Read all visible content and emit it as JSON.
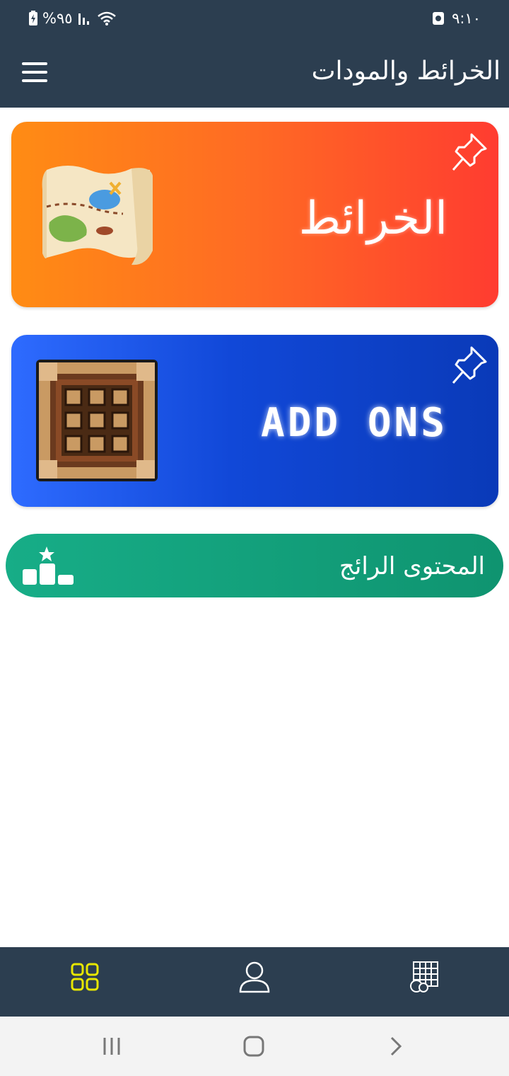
{
  "status_bar": {
    "battery": "%٩٥",
    "time": "٩:١٠"
  },
  "app_bar": {
    "title": "الخرائط والمودات",
    "menu_icon": "hamburger-menu-icon"
  },
  "cards": {
    "maps": {
      "label": "الخرائط",
      "gradient": [
        "#ff8c14",
        "#ff3c30"
      ],
      "image": "treasure-map-icon",
      "pin_icon": "pin-icon"
    },
    "addons": {
      "label": "ADD ONS",
      "gradient": [
        "#2e6bff",
        "#0a3ab8"
      ],
      "image": "crafting-table-icon",
      "pin_icon": "pin-icon"
    }
  },
  "trending": {
    "label": "المحتوى الرائج",
    "icon": "podium-star-icon",
    "color": "#17ad87"
  },
  "bottom_nav": {
    "items": [
      {
        "icon": "grid-icon",
        "active": true,
        "color": "#e6e600"
      },
      {
        "icon": "user-icon",
        "active": false
      },
      {
        "icon": "map-fruit-icon",
        "active": false
      }
    ]
  },
  "system_nav": {
    "items": [
      "recents-icon",
      "home-icon",
      "back-icon"
    ]
  }
}
